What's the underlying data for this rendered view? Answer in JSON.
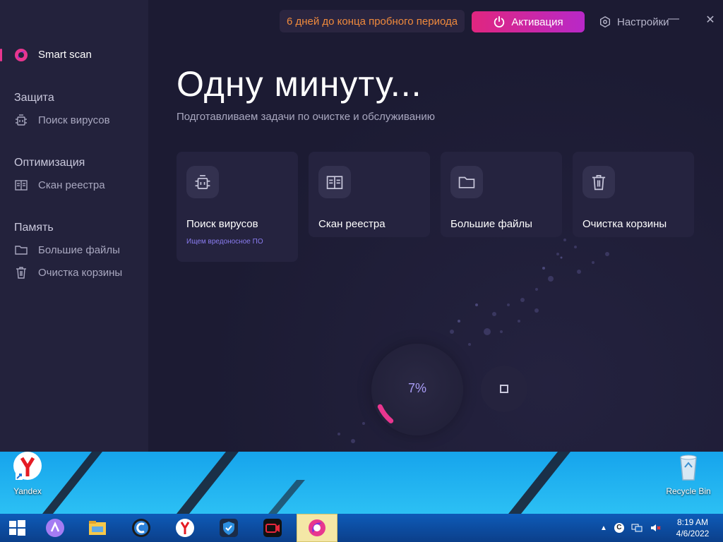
{
  "app": {
    "trial_notice": "6 дней до конца пробного периода",
    "activate_label": "Активация",
    "settings_label": "Настройки",
    "minimize_symbol": "—",
    "close_symbol": "✕"
  },
  "sidebar": {
    "active_item": {
      "label": "Smart scan",
      "icon": "app-logo-icon"
    },
    "sections": [
      {
        "title": "Защита",
        "items": [
          {
            "label": "Поиск вирусов",
            "icon": "bug-icon"
          }
        ]
      },
      {
        "title": "Оптимизация",
        "items": [
          {
            "label": "Скан реестра",
            "icon": "book-icon"
          }
        ]
      },
      {
        "title": "Память",
        "items": [
          {
            "label": "Большие файлы",
            "icon": "folder-icon"
          },
          {
            "label": "Очистка корзины",
            "icon": "trash-icon"
          }
        ]
      }
    ]
  },
  "main": {
    "title": "Одну минуту...",
    "subtitle": "Подготавливаем задачи по очистке и обслуживанию",
    "cards": [
      {
        "title": "Поиск вирусов",
        "status": "Ищем вредоносное ПО",
        "icon": "bug-icon"
      },
      {
        "title": "Скан реестра",
        "status": "",
        "icon": "book-icon"
      },
      {
        "title": "Большие файлы",
        "status": "",
        "icon": "folder-icon"
      },
      {
        "title": "Очистка корзины",
        "status": "",
        "icon": "trash-icon"
      }
    ],
    "progress_label": "7%",
    "progress_value": 0.07
  },
  "desktop": {
    "icons": [
      {
        "label": "Yandex",
        "icon": "yandex-browser-icon"
      },
      {
        "label": "Recycle Bin",
        "icon": "recycle-bin-icon"
      }
    ]
  },
  "taskbar": {
    "items": [
      "start-icon",
      "alice-icon",
      "file-explorer-icon",
      "ccleaner-icon",
      "yandex-browser-icon",
      "vpn-shield-icon",
      "screen-recorder-icon",
      "cleaner-app-icon"
    ],
    "tray_icons": [
      "chevron-up-icon",
      "ccleaner-tray-icon",
      "network-icon",
      "volume-muted-icon"
    ],
    "time": "8:19 AM",
    "date": "4/6/2022"
  },
  "colors": {
    "accent_pink": "#e0267f",
    "accent_purple": "#b828c8",
    "trial_orange": "#f08a3c",
    "status_violet": "#8a7cf0"
  }
}
